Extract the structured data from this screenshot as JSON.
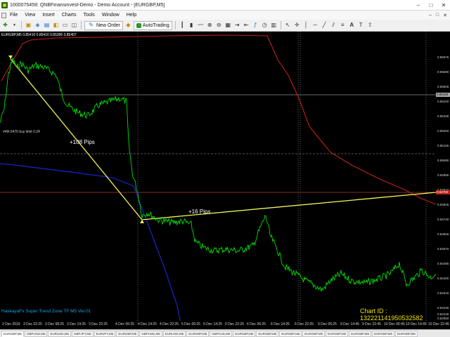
{
  "window": {
    "title": "1000075459: QNBFinansinvest-Demo - Demo Account - [EURGBP,M5]",
    "controls": [
      "–",
      "□",
      "✕"
    ]
  },
  "menu": {
    "items": [
      "File",
      "View",
      "Insert",
      "Charts",
      "Tools",
      "Window",
      "Help"
    ],
    "mdi_controls": [
      "–",
      "□",
      "✕"
    ]
  },
  "toolbar": {
    "new_order_label": "New Order",
    "autotrading_label": "AutoTrading"
  },
  "chart": {
    "header": "EURGBP,M5  0.85410 0.85416 0.85395 0.85407",
    "hline_label": "#49l 6476 buy limit 0.24",
    "annotation_1": "+108 Pips",
    "annotation_2": "+16 Pips",
    "indicator_name": "HaskayaFx Super Trend Zone TF M5 Ver.01",
    "chart_id": "Chart ID : 132221141950532582",
    "price_labels": [
      "0.85675",
      "0.85590",
      "0.85505",
      "0.85420",
      "0.85335",
      "0.85250",
      "0.85165",
      "0.85080",
      "0.84995",
      "0.84910",
      "0.84825",
      "0.84740",
      "0.84655",
      "0.84570",
      "0.84485",
      "0.84400",
      "0.84315",
      "0.84230",
      "0.84145",
      "0.84060"
    ],
    "price_tag_grey": "0.85430",
    "price_tag_red": "0.84780",
    "time_labels": [
      "2 Dec 2019",
      "3 Dec 02:25",
      "3 Dec 08:25",
      "3 Dec 14:25",
      "3 Dec 22:25",
      "4 Dec 06:25",
      "4 Dec 14:25",
      "4 Dec 22:25",
      "5 Dec 06:25",
      "5 Dec 14:25",
      "5 Dec 22:25",
      "6 Dec 06:25",
      "6 Dec 14:25",
      "6 Dec 22:25",
      "9 Dec 06:25",
      "9 Dec 14:45",
      "9 Dec 22:45",
      "10 Dec 06:45",
      "10 Dec 14:45",
      "10 Dec 22:45"
    ],
    "colors": {
      "background": "#000000",
      "price_line": "#00e000",
      "trend_red": "#c0211b",
      "trend_blue": "#1a24c8",
      "trendline": "#f5f55a",
      "hline_red": "#b03a2a",
      "hline_grey": "#808080"
    }
  },
  "tabs": [
    "EURGBP,M5",
    "GBPUSD,M5",
    "EURUSD,M5",
    "GBPJPY,M5",
    "EURJPY,M5",
    "EURGBP,M5",
    "GBPUSD,M5",
    "EURUSD,M5",
    "EURGBP,M5",
    "GBPAUD,M5",
    "EURGBP,M5",
    "EURGBP,M5",
    "EURGBP,M5",
    "EURGBP,M5",
    "EURGBP,M5",
    "EURGBP,M5",
    "EURGBP,M5",
    "EURGBP,M5"
  ]
}
